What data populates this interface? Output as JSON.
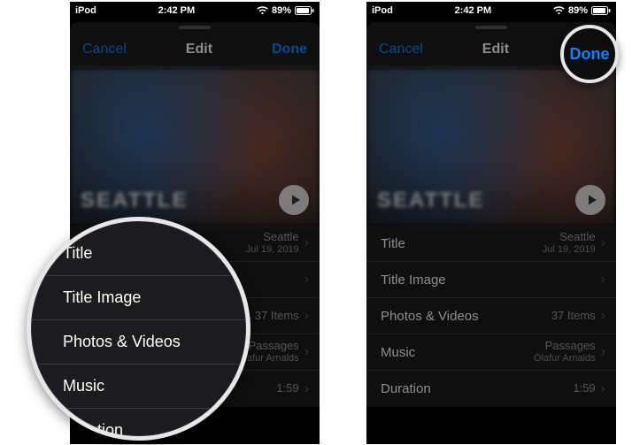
{
  "status": {
    "carrier": "iPod",
    "time": "2:42 PM",
    "battery_pct": "89%"
  },
  "nav": {
    "cancel": "Cancel",
    "title": "Edit",
    "done": "Done"
  },
  "hero": {
    "title_blur": "SEATTLE",
    "play_icon_name": "play-icon"
  },
  "rows": {
    "title": {
      "label": "Title",
      "value": "Seattle",
      "sub": "Jul 19, 2019"
    },
    "title_image": {
      "label": "Title Image",
      "value": ""
    },
    "photos": {
      "label": "Photos & Videos",
      "value": "37 Items"
    },
    "music": {
      "label": "Music",
      "value": "Passages",
      "sub": "Ólafur Arnalds"
    },
    "duration": {
      "label": "Duration",
      "value": "1:59"
    }
  },
  "magnifier": {
    "items": [
      "Title",
      "Title Image",
      "Photos & Videos",
      "Music",
      "Duration"
    ]
  },
  "done_highlight": {
    "label": "Done"
  }
}
